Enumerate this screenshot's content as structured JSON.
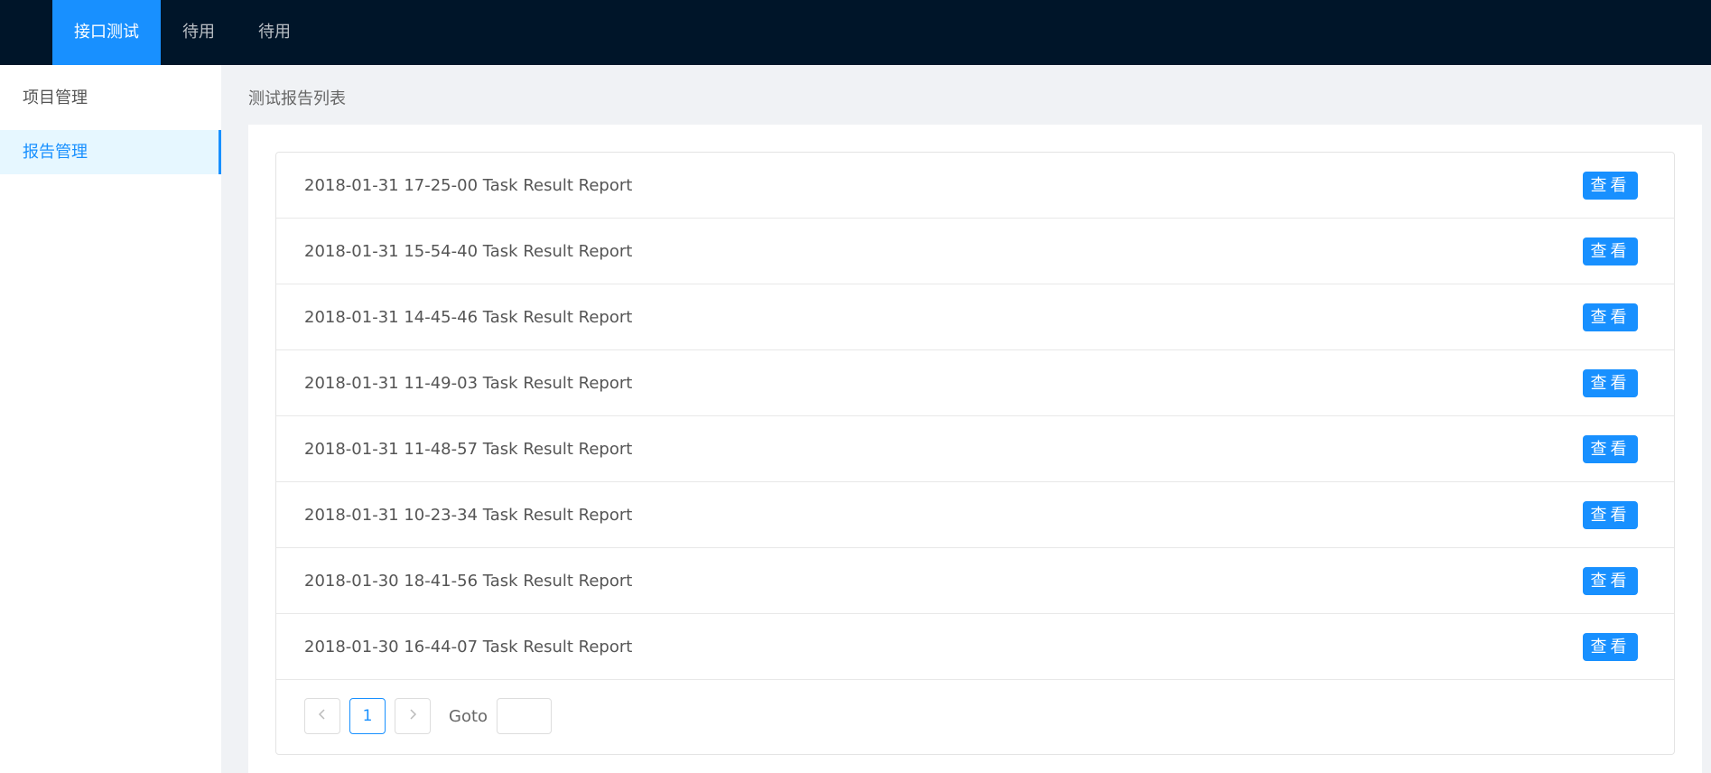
{
  "topnav": {
    "items": [
      {
        "label": "接口测试",
        "active": true
      },
      {
        "label": "待用",
        "active": false
      },
      {
        "label": "待用",
        "active": false
      }
    ]
  },
  "sidebar": {
    "items": [
      {
        "label": "项目管理",
        "active": false
      },
      {
        "label": "报告管理",
        "active": true
      }
    ]
  },
  "breadcrumb": "测试报告列表",
  "reports": {
    "view_label": "查看",
    "rows": [
      "2018-01-31 17-25-00 Task Result Report",
      "2018-01-31 15-54-40 Task Result Report",
      "2018-01-31 14-45-46 Task Result Report",
      "2018-01-31 11-49-03 Task Result Report",
      "2018-01-31 11-48-57 Task Result Report",
      "2018-01-31 10-23-34 Task Result Report",
      "2018-01-30 18-41-56 Task Result Report",
      "2018-01-30 16-44-07 Task Result Report"
    ]
  },
  "pagination": {
    "prev_icon": "chevron-left-icon",
    "next_icon": "chevron-right-icon",
    "current_page": "1",
    "goto_label": "Goto",
    "goto_value": ""
  },
  "colors": {
    "header_bg": "#001529",
    "accent": "#1890ff",
    "active_bg": "#e6f7ff"
  }
}
